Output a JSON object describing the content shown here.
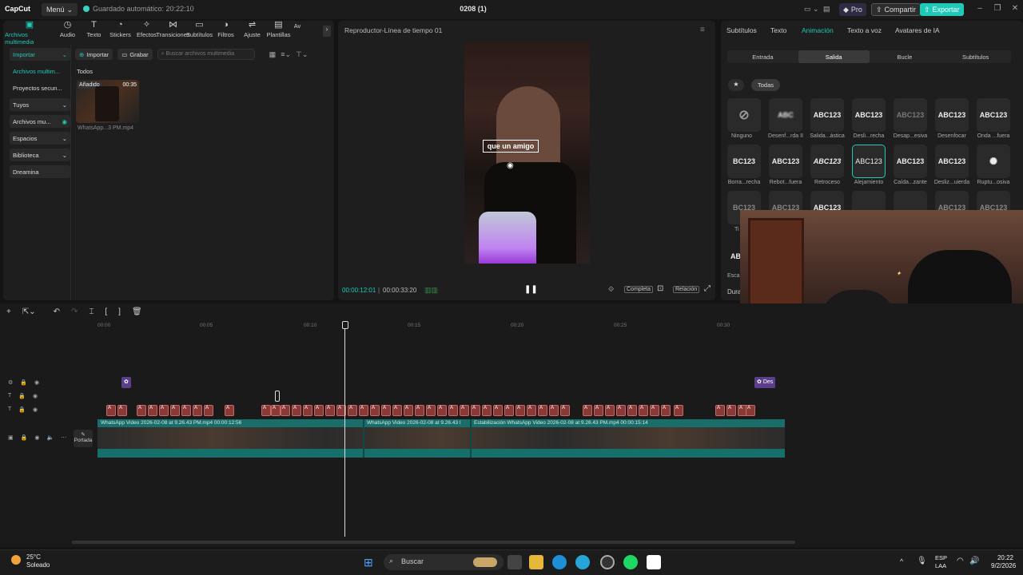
{
  "titlebar": {
    "app": "CapCut",
    "menu": "Menú",
    "autosave": "Guardado automático: 20:22:10",
    "project": "0208 (1)",
    "pro": "Pro",
    "share": "Compartir",
    "export": "Exportar"
  },
  "tools": [
    {
      "label": "Archivos multimedia",
      "icon": "media-icon"
    },
    {
      "label": "Audio",
      "icon": "audio-icon"
    },
    {
      "label": "Texto",
      "icon": "text-icon"
    },
    {
      "label": "Stickers",
      "icon": "stickers-icon"
    },
    {
      "label": "Efectos",
      "icon": "effects-icon"
    },
    {
      "label": "Transiciones",
      "icon": "transitions-icon"
    },
    {
      "label": "Subtítulos",
      "icon": "subtitles-icon"
    },
    {
      "label": "Filtros",
      "icon": "filters-icon"
    },
    {
      "label": "Ajuste",
      "icon": "adjust-icon"
    },
    {
      "label": "Plantillas",
      "icon": "templates-icon"
    },
    {
      "label": "Av",
      "icon": "avatar-icon"
    }
  ],
  "sidebar": [
    {
      "label": "Importar"
    },
    {
      "label": "Archivos multim..."
    },
    {
      "label": "Proyectos secun..."
    },
    {
      "label": "Tuyos"
    },
    {
      "label": "Archivos mu..."
    },
    {
      "label": "Espacios"
    },
    {
      "label": "Biblioteca"
    },
    {
      "label": "Dreamina"
    }
  ],
  "media": {
    "import": "Importar",
    "record": "Grabar",
    "search_placeholder": "Buscar archivos multimedia",
    "group": "Todos",
    "item_tag": "Añadido",
    "item_duration": "00:35",
    "item_name": "WhatsApp...3 PM.mp4"
  },
  "player": {
    "title": "Reproductor-Línea de tiempo 01",
    "caption": "que un amigo",
    "current_time": "00:00:12:01",
    "total_time": "00:00:33:20",
    "full": "Completa",
    "ratio": "Relación"
  },
  "props": {
    "tabs": [
      "Subtítulos",
      "Texto",
      "Animación",
      "Texto a voz",
      "Avatares de IA"
    ],
    "subtabs": [
      "Entrada",
      "Salida",
      "Bucle",
      "Subtítulos"
    ],
    "filter": "Todas",
    "animations": [
      {
        "name": "Ninguno",
        "preview": ""
      },
      {
        "name": "Desenf...rda II",
        "preview": "ABC"
      },
      {
        "name": "Salida...ástica",
        "preview": "ABC123"
      },
      {
        "name": "Desli...recha",
        "preview": "ABC123"
      },
      {
        "name": "Desap...esiva",
        "preview": "ABC123"
      },
      {
        "name": "Desenfocar",
        "preview": "ABC123"
      },
      {
        "name": "Onda ...fuera",
        "preview": "ABC123"
      },
      {
        "name": "Borra...recha",
        "preview": "BC123"
      },
      {
        "name": "Rebot...fuera",
        "preview": "ABC123"
      },
      {
        "name": "Retroceso",
        "preview": "ABC123"
      },
      {
        "name": "Alejamiento",
        "preview": "ABC123"
      },
      {
        "name": "Caída...zante",
        "preview": "ABC123"
      },
      {
        "name": "Desliz...uierda",
        "preview": "ABC123"
      },
      {
        "name": "Ruptu...osiva",
        "preview": ""
      }
    ],
    "row3": [
      "BC123",
      "ABC123",
      "ABC123",
      "",
      "",
      "ABC123",
      "ABC123"
    ],
    "partial_labels": [
      "Ti",
      "AB",
      "Esca",
      "Dura"
    ]
  },
  "timeline": {
    "ruler": [
      "00:00",
      "00:05",
      "00:10",
      "00:15",
      "00:20",
      "00:25",
      "00:30"
    ],
    "clip1": "WhatsApp Video 2026-02-08 at 9.26.43 PM.mp4   00:00:12:56",
    "clip2": "WhatsApp Video 2026-02-08 at 9.26.43 I",
    "clip3": "Estabilización   WhatsApp Video 2026-02-08 at 9.26.43 PM.mp4   00:00:15:14",
    "cover": "Portada",
    "effect_end": "Des"
  },
  "taskbar": {
    "temp": "25°C",
    "weather": "Soleado",
    "search": "Buscar",
    "lang1": "ESP",
    "lang2": "LAA",
    "time": "20:22",
    "date": "9/2/2026"
  },
  "colors": {
    "accent": "#1fc9b8",
    "caption_clip": "#8a3a36",
    "video_track": "#1a6e6a"
  }
}
